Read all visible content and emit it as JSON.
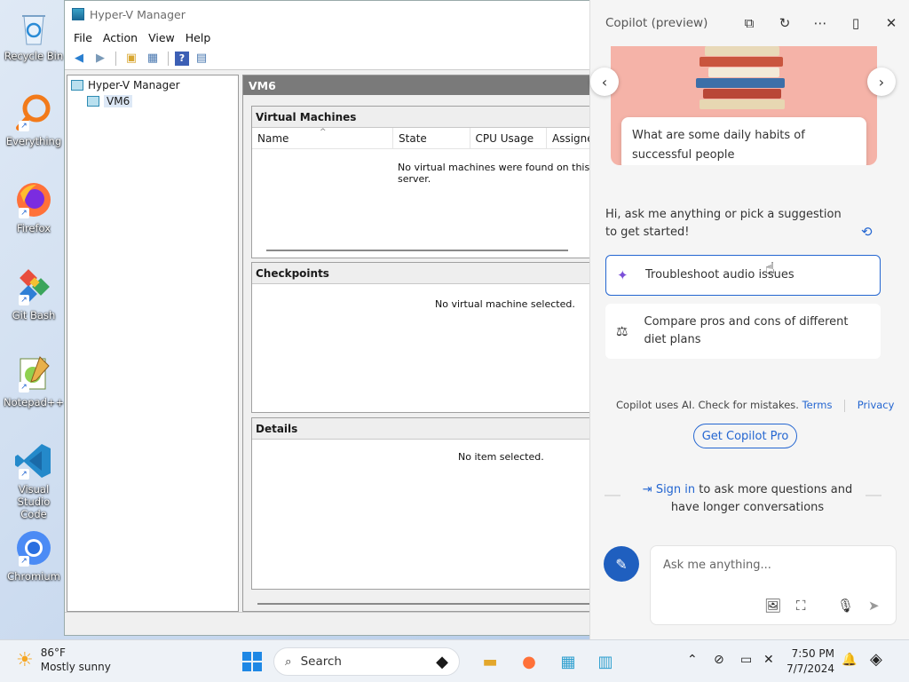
{
  "desktop": {
    "icons": [
      {
        "label": "Recycle Bin"
      },
      {
        "label": "Everything"
      },
      {
        "label": "Firefox"
      },
      {
        "label": "Git Bash"
      },
      {
        "label": "Notepad++"
      },
      {
        "label": "Visual Studio Code"
      },
      {
        "label": "Chromium"
      }
    ]
  },
  "hyperv": {
    "title": "Hyper-V Manager",
    "menu": [
      "File",
      "Action",
      "View",
      "Help"
    ],
    "tree": {
      "root": "Hyper-V Manager",
      "child": "VM6"
    },
    "content_header": "VM6",
    "vm_pane": {
      "title": "Virtual Machines",
      "columns": [
        "Name",
        "State",
        "CPU Usage",
        "Assigne"
      ],
      "empty": "No virtual machines were found on this server."
    },
    "checkpoints": {
      "title": "Checkpoints",
      "empty": "No virtual machine selected."
    },
    "details": {
      "title": "Details",
      "empty": "No item selected."
    }
  },
  "copilot": {
    "title": "Copilot (preview)",
    "hero_prompt": "What are some daily habits of successful people",
    "greeting": "Hi, ask me anything or pick a suggestion to get started!",
    "suggestions": [
      "Troubleshoot audio issues",
      "Compare pros and cons of different diet plans"
    ],
    "disclaimer": "Copilot uses AI. Check for mistakes.",
    "terms": "Terms",
    "privacy": "Privacy",
    "pro_button": "Get Copilot Pro",
    "signin_link": "Sign in",
    "signin_rest": "to ask more questions and have longer conversations",
    "input_placeholder": "Ask me anything..."
  },
  "taskbar": {
    "weather_temp": "86°F",
    "weather_desc": "Mostly sunny",
    "search_label": "Search",
    "time": "7:50 PM",
    "date": "7/7/2024"
  }
}
